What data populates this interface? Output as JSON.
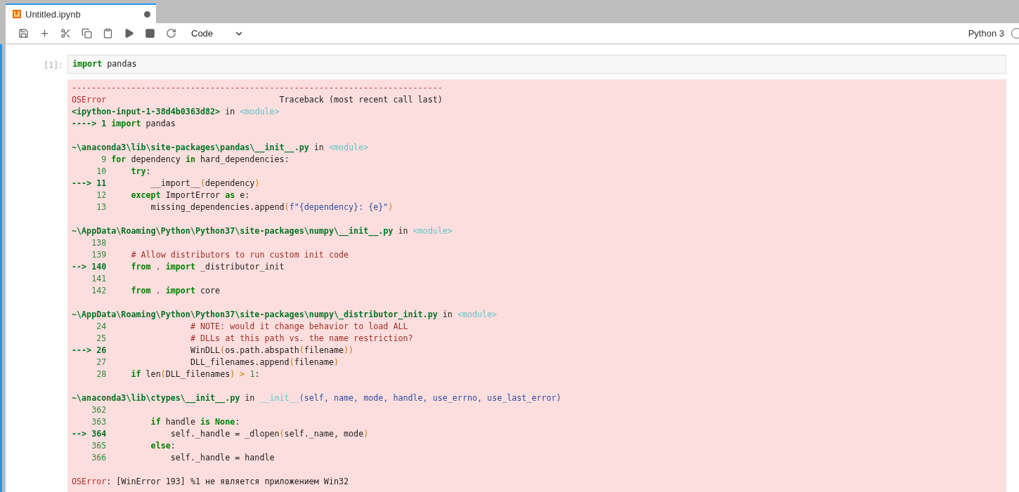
{
  "tab": {
    "title": "Untitled.ipynb",
    "modified": true
  },
  "toolbar": {
    "cell_type": "Code",
    "kernel": "Python 3"
  },
  "cell": {
    "prompt": "[1]:",
    "active": true,
    "code": [
      {
        "kind": "keyword",
        "text": "import"
      },
      {
        "kind": "text",
        "text": " pandas"
      }
    ],
    "output": [
      {
        "kind": "code",
        "segments": [
          {
            "kind": "error",
            "text": "---------------------------------------------------------------------------"
          }
        ]
      },
      {
        "kind": "code",
        "segments": [
          {
            "kind": "error",
            "text": "OSError"
          },
          {
            "kind": "text",
            "text": "                                   Traceback (most recent call last)"
          }
        ]
      },
      {
        "kind": "code",
        "segments": [
          {
            "kind": "path",
            "text": "<ipython-input-1-38d4b0363d82>"
          },
          {
            "kind": "text",
            "text": " in "
          },
          {
            "kind": "module",
            "text": "<module>"
          }
        ]
      },
      {
        "kind": "code",
        "segments": [
          {
            "kind": "current",
            "text": "----> 1 "
          },
          {
            "kind": "keyword",
            "text": "import"
          },
          {
            "kind": "text",
            "text": " pandas"
          }
        ]
      },
      {
        "kind": "blank"
      },
      {
        "kind": "code",
        "segments": [
          {
            "kind": "path",
            "text": "~\\anaconda3\\lib\\site-packages\\pandas\\__init__.py"
          },
          {
            "kind": "text",
            "text": " in "
          },
          {
            "kind": "module",
            "text": "<module>"
          }
        ]
      },
      {
        "kind": "code",
        "segments": [
          {
            "kind": "lineno",
            "text": "      9 "
          },
          {
            "kind": "keyword",
            "text": "for"
          },
          {
            "kind": "text",
            "text": " dependency "
          },
          {
            "kind": "keyword",
            "text": "in"
          },
          {
            "kind": "text",
            "text": " hard_dependencies:"
          }
        ]
      },
      {
        "kind": "code",
        "segments": [
          {
            "kind": "lineno",
            "text": "     10     "
          },
          {
            "kind": "keyword",
            "text": "try"
          },
          {
            "kind": "text",
            "text": ":"
          }
        ]
      },
      {
        "kind": "code",
        "segments": [
          {
            "kind": "current",
            "text": "---> 11 "
          },
          {
            "kind": "text",
            "text": "        __import__"
          },
          {
            "kind": "paren",
            "text": "("
          },
          {
            "kind": "text",
            "text": "dependency"
          },
          {
            "kind": "paren",
            "text": ")"
          }
        ]
      },
      {
        "kind": "code",
        "segments": [
          {
            "kind": "lineno",
            "text": "     12     "
          },
          {
            "kind": "keyword",
            "text": "except"
          },
          {
            "kind": "text",
            "text": " ImportError "
          },
          {
            "kind": "keyword",
            "text": "as"
          },
          {
            "kind": "text",
            "text": " e:"
          }
        ]
      },
      {
        "kind": "code",
        "segments": [
          {
            "kind": "lineno",
            "text": "     13 "
          },
          {
            "kind": "text",
            "text": "        missing_dependencies.append"
          },
          {
            "kind": "paren",
            "text": "("
          },
          {
            "kind": "args",
            "text": "f\"{dependency}: {e}\""
          },
          {
            "kind": "paren",
            "text": ")"
          }
        ]
      },
      {
        "kind": "blank"
      },
      {
        "kind": "code",
        "segments": [
          {
            "kind": "path",
            "text": "~\\AppData\\Roaming\\Python\\Python37\\site-packages\\numpy\\__init__.py"
          },
          {
            "kind": "text",
            "text": " in "
          },
          {
            "kind": "module",
            "text": "<module>"
          }
        ]
      },
      {
        "kind": "code",
        "segments": [
          {
            "kind": "lineno",
            "text": "    138 "
          }
        ]
      },
      {
        "kind": "code",
        "segments": [
          {
            "kind": "lineno",
            "text": "    139     "
          },
          {
            "kind": "comment",
            "text": "# Allow distributors to run custom init code"
          }
        ]
      },
      {
        "kind": "code",
        "segments": [
          {
            "kind": "current",
            "text": "--> 140     "
          },
          {
            "kind": "keyword",
            "text": "from"
          },
          {
            "kind": "text",
            "text": " . "
          },
          {
            "kind": "keyword",
            "text": "import"
          },
          {
            "kind": "text",
            "text": " _distributor_init"
          }
        ]
      },
      {
        "kind": "code",
        "segments": [
          {
            "kind": "lineno",
            "text": "    141 "
          }
        ]
      },
      {
        "kind": "code",
        "segments": [
          {
            "kind": "lineno",
            "text": "    142     "
          },
          {
            "kind": "keyword",
            "text": "from"
          },
          {
            "kind": "text",
            "text": " . "
          },
          {
            "kind": "keyword",
            "text": "import"
          },
          {
            "kind": "text",
            "text": " core"
          }
        ]
      },
      {
        "kind": "blank"
      },
      {
        "kind": "code",
        "segments": [
          {
            "kind": "path",
            "text": "~\\AppData\\Roaming\\Python\\Python37\\site-packages\\numpy\\_distributor_init.py"
          },
          {
            "kind": "text",
            "text": " in "
          },
          {
            "kind": "module",
            "text": "<module>"
          }
        ]
      },
      {
        "kind": "code",
        "segments": [
          {
            "kind": "lineno",
            "text": "     24                 "
          },
          {
            "kind": "comment",
            "text": "# NOTE: would it change behavior to load ALL"
          }
        ]
      },
      {
        "kind": "code",
        "segments": [
          {
            "kind": "lineno",
            "text": "     25                 "
          },
          {
            "kind": "comment",
            "text": "# DLLs at this path vs. the name restriction?"
          }
        ]
      },
      {
        "kind": "code",
        "segments": [
          {
            "kind": "current",
            "text": "---> 26 "
          },
          {
            "kind": "text",
            "text": "                WinDLL"
          },
          {
            "kind": "paren",
            "text": "("
          },
          {
            "kind": "text",
            "text": "os.path.abspath"
          },
          {
            "kind": "paren",
            "text": "("
          },
          {
            "kind": "text",
            "text": "filename"
          },
          {
            "kind": "paren",
            "text": "))"
          }
        ]
      },
      {
        "kind": "code",
        "segments": [
          {
            "kind": "lineno",
            "text": "     27 "
          },
          {
            "kind": "text",
            "text": "                DLL_filenames.append"
          },
          {
            "kind": "paren",
            "text": "("
          },
          {
            "kind": "text",
            "text": "filename"
          },
          {
            "kind": "paren",
            "text": ")"
          }
        ]
      },
      {
        "kind": "code",
        "segments": [
          {
            "kind": "lineno",
            "text": "     28     "
          },
          {
            "kind": "keyword",
            "text": "if"
          },
          {
            "kind": "text",
            "text": " len"
          },
          {
            "kind": "paren",
            "text": "("
          },
          {
            "kind": "text",
            "text": "DLL_filenames"
          },
          {
            "kind": "paren",
            "text": ") > "
          },
          {
            "kind": "lineno",
            "text": "1"
          },
          {
            "kind": "text",
            "text": ":"
          }
        ]
      },
      {
        "kind": "blank"
      },
      {
        "kind": "code",
        "segments": [
          {
            "kind": "path",
            "text": "~\\anaconda3\\lib\\ctypes\\__init__.py"
          },
          {
            "kind": "text",
            "text": " in "
          },
          {
            "kind": "module",
            "text": "__init__"
          },
          {
            "kind": "args",
            "text": "(self, name, mode, handle, use_errno, use_last_error)"
          }
        ]
      },
      {
        "kind": "code",
        "segments": [
          {
            "kind": "lineno",
            "text": "    362 "
          }
        ]
      },
      {
        "kind": "code",
        "segments": [
          {
            "kind": "lineno",
            "text": "    363         "
          },
          {
            "kind": "keyword",
            "text": "if"
          },
          {
            "kind": "text",
            "text": " handle "
          },
          {
            "kind": "keyword",
            "text": "is None"
          },
          {
            "kind": "text",
            "text": ":"
          }
        ]
      },
      {
        "kind": "code",
        "segments": [
          {
            "kind": "current",
            "text": "--> 364 "
          },
          {
            "kind": "text",
            "text": "            self._handle = _dlopen"
          },
          {
            "kind": "paren",
            "text": "("
          },
          {
            "kind": "text",
            "text": "self._name, mode"
          },
          {
            "kind": "paren",
            "text": ")"
          }
        ]
      },
      {
        "kind": "code",
        "segments": [
          {
            "kind": "lineno",
            "text": "    365         "
          },
          {
            "kind": "keyword",
            "text": "else"
          },
          {
            "kind": "text",
            "text": ":"
          }
        ]
      },
      {
        "kind": "code",
        "segments": [
          {
            "kind": "lineno",
            "text": "    366 "
          },
          {
            "kind": "text",
            "text": "            self._handle = handle"
          }
        ]
      },
      {
        "kind": "blank"
      },
      {
        "kind": "code",
        "segments": [
          {
            "kind": "error",
            "text": "OSError"
          },
          {
            "kind": "text",
            "text": ": [WinError 193] %1 не является приложением Win32"
          }
        ]
      }
    ]
  }
}
